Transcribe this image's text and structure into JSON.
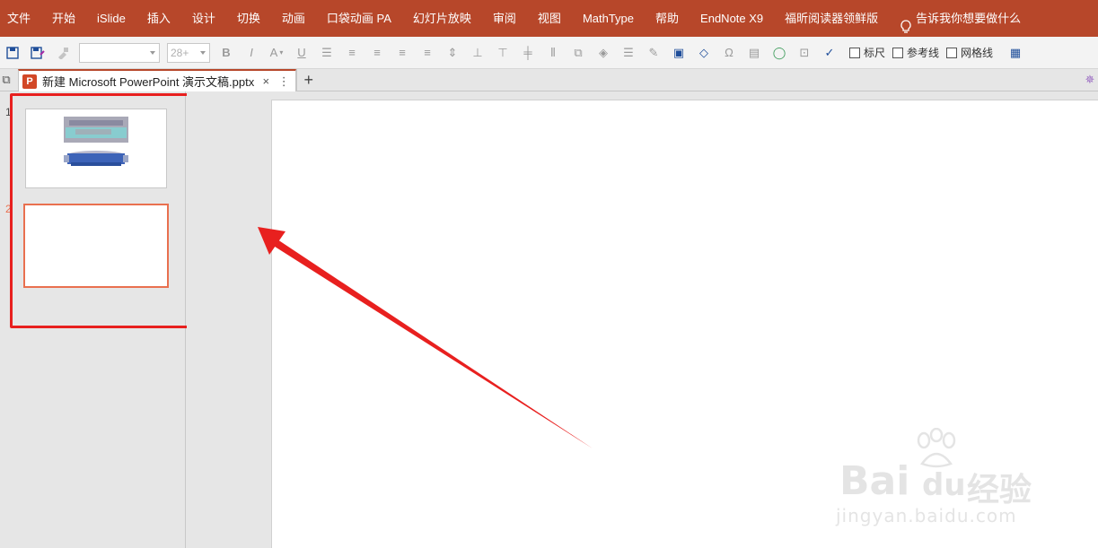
{
  "menu": [
    "文件",
    "开始",
    "iSlide",
    "插入",
    "设计",
    "切换",
    "动画",
    "口袋动画 PA",
    "幻灯片放映",
    "审阅",
    "视图",
    "MathType",
    "帮助",
    "EndNote X9",
    "福昕阅读器领鲜版"
  ],
  "tell_me": "告诉我你想要做什么",
  "toolbar": {
    "font_size": "28+",
    "bold": "B",
    "italic": "I",
    "underline": "U",
    "omega": "Ω",
    "checkbox_ruler": "标尺",
    "checkbox_guides": "参考线",
    "checkbox_grid": "网格线"
  },
  "doc_tab": {
    "title": "新建 Microsoft PowerPoint 演示文稿.pptx",
    "logo": "P",
    "close": "×",
    "more": "⋮",
    "add": "+"
  },
  "slides": [
    {
      "number": "1",
      "has_content": true
    },
    {
      "number": "2",
      "has_content": false,
      "selected": true
    }
  ],
  "watermark": {
    "brand_bai": "Bai",
    "brand_du": "du",
    "brand_cn": "经验",
    "url": "jingyan.baidu.com"
  },
  "colors": {
    "ribbon": "#b7472a",
    "annotation_red": "#e8201f",
    "selection_orange": "#e9704f"
  }
}
